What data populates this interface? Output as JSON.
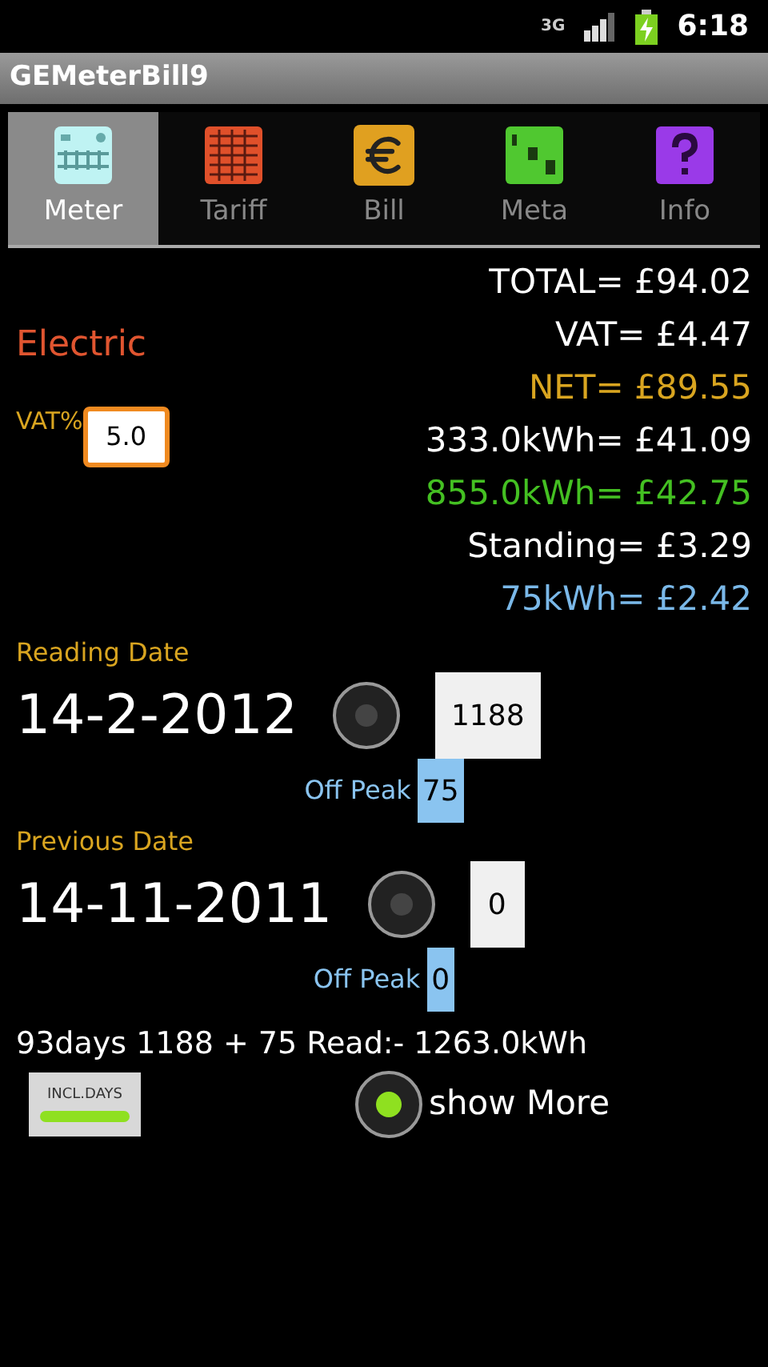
{
  "status_bar": {
    "network": "3G",
    "time": "6:18"
  },
  "window": {
    "title": "GEMeterBill9"
  },
  "tabs": [
    {
      "label": "Meter",
      "kind": "meter",
      "selected": true
    },
    {
      "label": "Tariff",
      "kind": "tariff",
      "selected": false
    },
    {
      "label": "Bill",
      "kind": "bill",
      "selected": false
    },
    {
      "label": "Meta",
      "kind": "meta",
      "selected": false
    },
    {
      "label": "Info",
      "kind": "info",
      "selected": false
    }
  ],
  "fuel": "Electric",
  "vat": {
    "label": "VAT%",
    "value": "5.0"
  },
  "totals": [
    {
      "text": "TOTAL= £94.02",
      "color": "#ffffff"
    },
    {
      "text": "VAT= £4.47",
      "color": "#ffffff"
    },
    {
      "text": "NET= £89.55",
      "color": "#d9a520"
    },
    {
      "text": "333.0kWh= £41.09",
      "color": "#ffffff"
    },
    {
      "text": "855.0kWh= £42.75",
      "color": "#44c022"
    },
    {
      "text": "Standing= £3.29",
      "color": "#ffffff"
    },
    {
      "text": "75kWh= £2.42",
      "color": "#7ab8e8"
    }
  ],
  "readings": [
    {
      "label": "Reading Date",
      "date": "14-2-2012",
      "selected": false,
      "value": "1188",
      "off_peak_label": "Off Peak",
      "off_peak": "75"
    },
    {
      "label": "Previous Date",
      "date": "14-11-2011",
      "selected": false,
      "value": "0",
      "off_peak_label": "Off Peak",
      "off_peak": "0"
    }
  ],
  "summary": "93days 1188 + 75 Read:- 1263.0kWh",
  "incl_days": {
    "label": "INCL.DAYS",
    "on": true
  },
  "show_more": {
    "label": "show More",
    "selected": true
  }
}
